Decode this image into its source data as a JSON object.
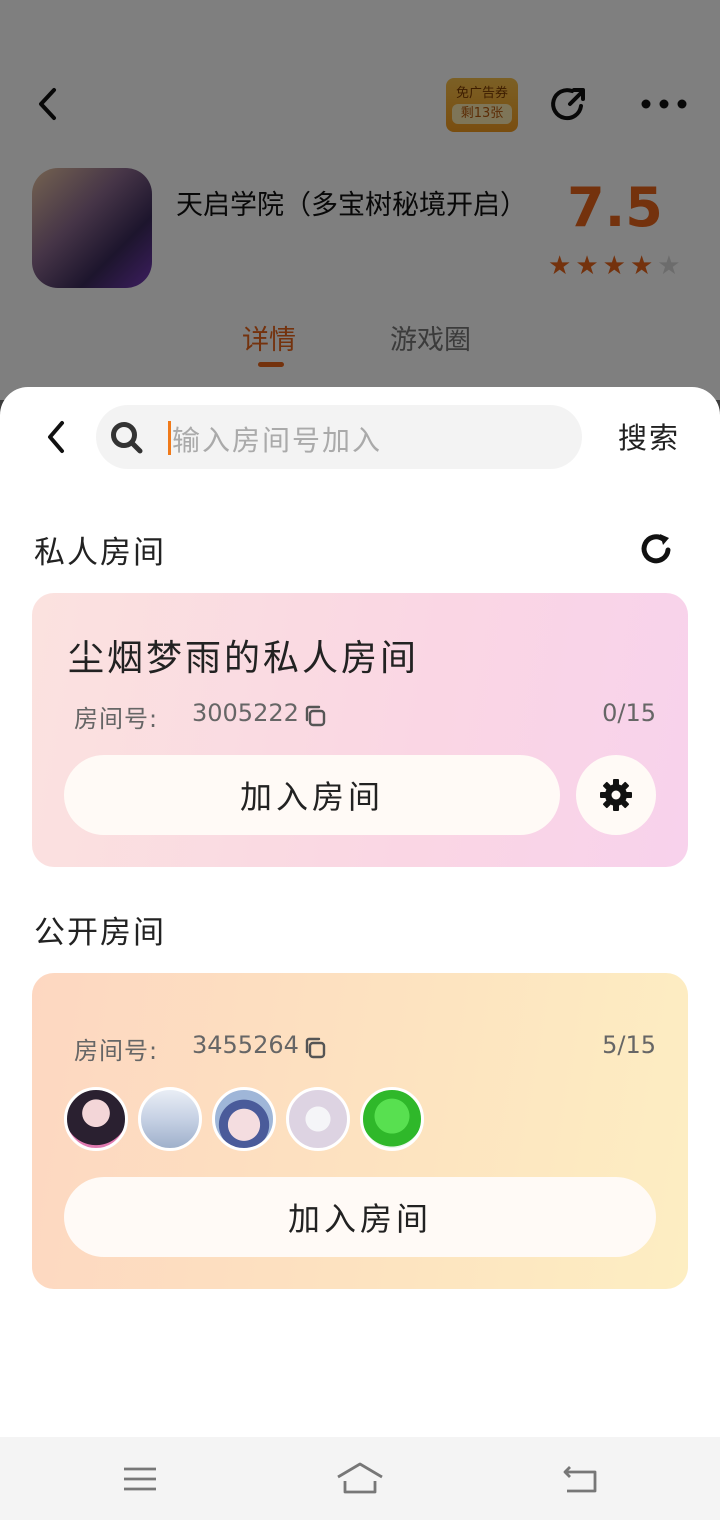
{
  "header": {
    "coupon_line1": "免广告券",
    "coupon_line2": "剩13张"
  },
  "app": {
    "title": "天启学院（多宝树秘境开启）",
    "score": "7.5",
    "stars": [
      "★",
      "★",
      "★",
      "★",
      "★"
    ],
    "star_rating": 4
  },
  "tabs": [
    {
      "label": "详情",
      "active": true
    },
    {
      "label": "游戏圈",
      "active": false
    }
  ],
  "search": {
    "placeholder": "输入房间号加入",
    "button": "搜索"
  },
  "private_section": {
    "title": "私人房间",
    "room": {
      "name": "尘烟梦雨的私人房间",
      "id_label": "房间号:",
      "id": "3005222",
      "count": "0/15",
      "join_label": "加入房间"
    }
  },
  "public_section": {
    "title": "公开房间",
    "room": {
      "id_label": "房间号:",
      "id": "3455264",
      "count": "5/15",
      "join_label": "加入房间",
      "avatar_colors": [
        "#d9b7c9",
        "#c7d3e6",
        "#d8c0c6",
        "#ddd6e6",
        "#3fd43a"
      ]
    }
  },
  "colors": {
    "accent": "#e8641b",
    "caret": "#f07a1a"
  }
}
